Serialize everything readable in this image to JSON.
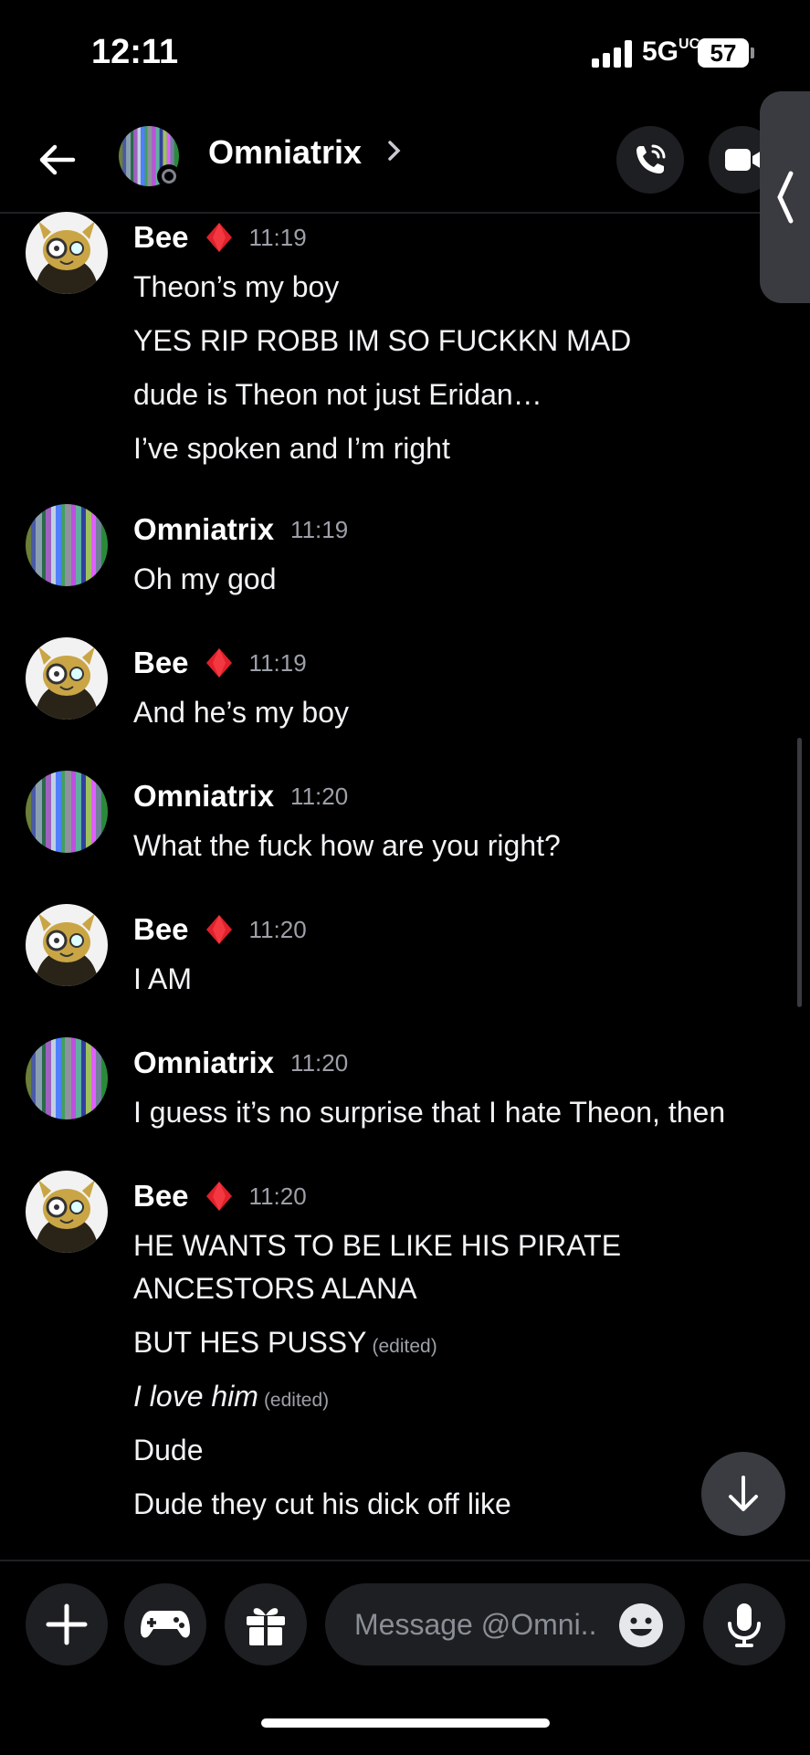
{
  "status_bar": {
    "time": "12:11",
    "network": "5G",
    "network_suffix": "UC",
    "battery": "57"
  },
  "header": {
    "title": "Omniatrix"
  },
  "messages": [
    {
      "author": "Bee",
      "time": "11:19",
      "avatar": "bee-avatar",
      "lines": [
        "Theon’s my boy",
        "YES RIP ROBB IM SO FUCKKN MAD",
        "dude is Theon not just Eridan…",
        "I’ve spoken and I’m right"
      ]
    },
    {
      "author": "Omniatrix",
      "time": "11:19",
      "avatar": "glitch-avatar",
      "lines": [
        "Oh my god"
      ]
    },
    {
      "author": "Bee",
      "time": "11:19",
      "avatar": "bee-avatar",
      "lines": [
        "And he’s my boy"
      ]
    },
    {
      "author": "Omniatrix",
      "time": "11:20",
      "avatar": "glitch-avatar",
      "lines": [
        "What the fuck how are you right?"
      ]
    },
    {
      "author": "Bee",
      "time": "11:20",
      "avatar": "bee-avatar",
      "lines": [
        "I AM"
      ]
    },
    {
      "author": "Omniatrix",
      "time": "11:20",
      "avatar": "glitch-avatar",
      "lines": [
        "I guess it’s no surprise that I hate Theon, then"
      ]
    },
    {
      "author": "Bee",
      "time": "11:20",
      "avatar": "bee-avatar",
      "lines": [
        "HE WANTS TO BE LIKE HIS PIRATE",
        "ANCESTORS ALANA",
        "BUT HES PUSSY",
        "I love him",
        "Dude",
        "Dude they cut his dick off like"
      ]
    }
  ],
  "edited_label": "(edited)",
  "composer": {
    "placeholder": "Message @Omni.."
  },
  "colors": {
    "background": "#000000",
    "surface": "#1e1f22",
    "gem": "#e0202a",
    "muted": "#9da0a8"
  },
  "icons": [
    "back-arrow-icon",
    "chevron-right-icon",
    "phone-call-icon",
    "video-camera-icon",
    "collapse-handle-icon",
    "red-gem-icon",
    "plus-icon",
    "gamepad-icon",
    "gift-icon",
    "emoji-icon",
    "microphone-icon",
    "arrow-down-icon"
  ]
}
